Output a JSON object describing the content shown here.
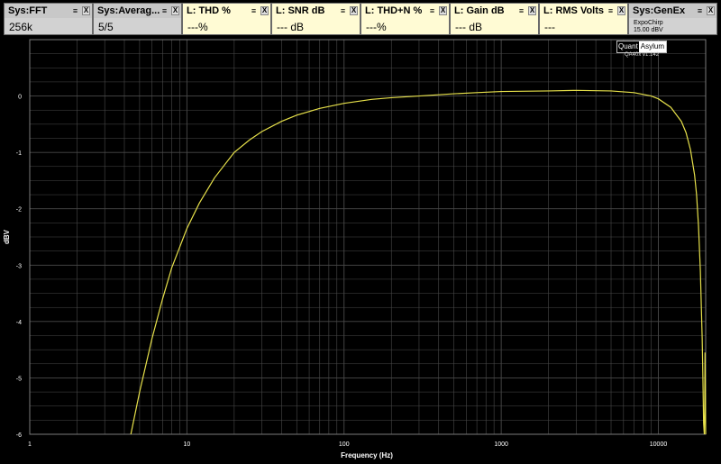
{
  "meters": [
    {
      "kind": "sys",
      "title": "Sys:FFT",
      "value": "256k"
    },
    {
      "kind": "sys",
      "title": "Sys:Averag...",
      "value": "5/5"
    },
    {
      "kind": "meas",
      "title": "L: THD %",
      "value": "---%"
    },
    {
      "kind": "meas",
      "title": "L: SNR dB",
      "value": "--- dB"
    },
    {
      "kind": "meas",
      "title": "L: THD+N %",
      "value": "---%"
    },
    {
      "kind": "meas",
      "title": "L: Gain dB",
      "value": "--- dB"
    },
    {
      "kind": "meas",
      "title": "L: RMS Volts",
      "value": "---"
    },
    {
      "kind": "gen",
      "title": "Sys:GenEx",
      "line1": "ExpoChirp",
      "line2": "15.00 dBV"
    }
  ],
  "controls": {
    "menu_symbol": "≡",
    "close_symbol": "X"
  },
  "brand": {
    "part1": "Quant",
    "part2": "Asylum",
    "version": "QA40x v1.142"
  },
  "chart_data": {
    "type": "line",
    "xlabel": "Frequency (Hz)",
    "ylabel": "dBV",
    "x_scale": "log",
    "xlim": [
      1,
      20000
    ],
    "ylim": [
      -6,
      1
    ],
    "x_ticks": [
      1,
      10,
      100,
      1000,
      10000
    ],
    "x_tick_labels": [
      "1",
      "10",
      "100",
      "1000",
      "10000"
    ],
    "y_ticks": [
      0,
      -1,
      -2,
      -3,
      -4,
      -5,
      -6
    ],
    "y_tick_labels": [
      "0",
      "-1",
      "-2",
      "-3",
      "-4",
      "-5",
      "-6"
    ],
    "grid": true,
    "colors": {
      "background": "#000000",
      "grid": "#4a4a4a",
      "trace": "#e6e04a",
      "text": "#ffffff"
    },
    "series": [
      {
        "x": [
          4.4,
          5,
          6,
          7,
          8,
          10,
          12,
          15,
          20,
          25,
          30,
          40,
          50,
          70,
          100,
          150,
          200,
          300,
          500,
          700,
          1000,
          2000,
          3000,
          5000,
          7000,
          9000,
          10000,
          12000,
          14000,
          15000,
          16000,
          17000,
          17500,
          18000,
          18500,
          19000,
          19200,
          19400,
          19600,
          19700,
          19800,
          19900,
          20000
        ],
        "y": [
          -6,
          -5.25,
          -4.3,
          -3.6,
          -3.05,
          -2.35,
          -1.9,
          -1.45,
          -1.0,
          -0.78,
          -0.63,
          -0.45,
          -0.34,
          -0.22,
          -0.13,
          -0.06,
          -0.03,
          0.0,
          0.04,
          0.06,
          0.08,
          0.09,
          0.1,
          0.09,
          0.06,
          0.0,
          -0.05,
          -0.2,
          -0.45,
          -0.65,
          -0.95,
          -1.4,
          -1.75,
          -2.3,
          -3.1,
          -4.3,
          -5.0,
          -5.8,
          -6,
          -5.6,
          -4.55,
          -5.2,
          -6
        ]
      }
    ]
  }
}
